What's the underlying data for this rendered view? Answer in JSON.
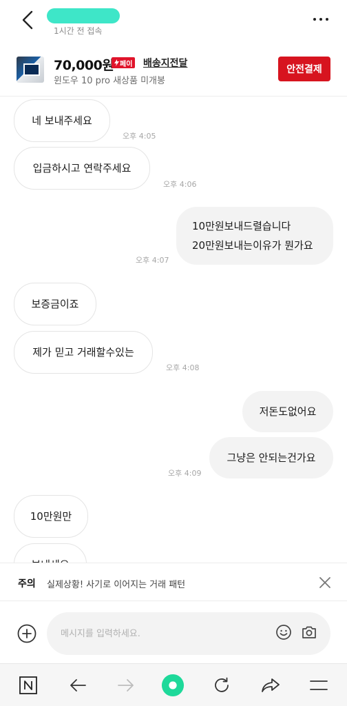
{
  "header": {
    "last_seen": "1시간 전 접속"
  },
  "product": {
    "price": "70,000원",
    "pay_badge": "페이",
    "delivery": "배송지전달",
    "title": "윈도우 10 pro 새상품 미개봉",
    "safe_pay_label": "안전결제"
  },
  "chat": {
    "messages": [
      {
        "side": "theirs",
        "text": "네 보내주세요",
        "time": "오후 4:05"
      },
      {
        "side": "theirs",
        "text": "입금하시고 연락주세요",
        "time": "오후 4:06"
      },
      {
        "side": "mine",
        "lines": [
          "10만원보내드렬습니다",
          "20만원보내는이유가 뭔가요"
        ],
        "time": "오후 4:07"
      },
      {
        "side": "theirs",
        "text": "보증금이죠",
        "time": ""
      },
      {
        "side": "theirs",
        "text": "제가 믿고 거래할수있는",
        "time": "오후 4:08"
      },
      {
        "side": "mine",
        "text": "저돈도없어요",
        "time": ""
      },
      {
        "side": "mine",
        "text": "그냥은 안되는건가요",
        "time": "오후 4:09"
      },
      {
        "side": "theirs",
        "text": "10만원만",
        "time": ""
      },
      {
        "side": "theirs",
        "text": "보내세요",
        "time": ""
      }
    ]
  },
  "warning": {
    "label": "주의",
    "text": "실제상황! 사기로 이어지는 거래 패턴"
  },
  "input": {
    "placeholder": "메시지를 입력하세요."
  },
  "colors": {
    "accent_red": "#d7141f",
    "name_highlight": "#3ee6c8",
    "home_green": "#1ed99a"
  }
}
